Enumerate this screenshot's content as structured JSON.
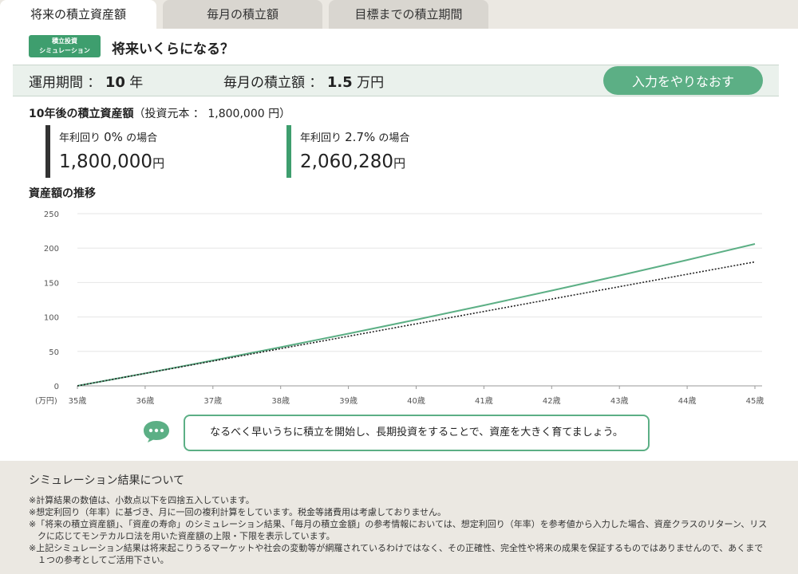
{
  "tabs": [
    {
      "label": "将来の積立資産額",
      "active": true
    },
    {
      "label": "毎月の積立額",
      "active": false
    },
    {
      "label": "目標までの積立期間",
      "active": false
    }
  ],
  "badge": {
    "line1": "積立投資",
    "line2": "シミュレーション"
  },
  "page_title": "将来いくらになる？",
  "conditions": {
    "period_label": "運用期間 ：",
    "period_value": "10",
    "period_unit": "年",
    "monthly_label": "毎月の積立額 ：",
    "monthly_value": "1.5",
    "monthly_unit": "万円",
    "reset_label": "入力をやりなおす"
  },
  "result": {
    "title": "10年後の積立資産額",
    "principal": "（投資元本 ： 1,800,000 円）",
    "scenarios": [
      {
        "prefix": "年利回り ",
        "rate": "0%",
        "suffix": " の場合",
        "amount": "1,800,000",
        "unit": "円",
        "color": "#333333"
      },
      {
        "prefix": "年利回り ",
        "rate": "2.7%",
        "suffix": " の場合",
        "amount": "2,060,280",
        "unit": "円",
        "color": "#3e9e6e"
      }
    ]
  },
  "chart_title": "資産額の推移",
  "chart_data": {
    "type": "line",
    "x": [
      "35歳",
      "36歳",
      "37歳",
      "38歳",
      "39歳",
      "40歳",
      "41歳",
      "42歳",
      "43歳",
      "44歳",
      "45歳"
    ],
    "yticks": [
      "0",
      "50",
      "100",
      "150",
      "200",
      "250"
    ],
    "ylim": [
      0,
      250
    ],
    "yunit": "(万円)",
    "grid": true,
    "series": [
      {
        "style": "solid",
        "color": "#5caf85",
        "values": [
          0,
          18.2,
          36.9,
          56.1,
          75.8,
          96.1,
          116.9,
          138.3,
          160.2,
          182.8,
          206.0
        ]
      },
      {
        "style": "dotted",
        "color": "#222222",
        "values": [
          0,
          18,
          36,
          54,
          72,
          90,
          108,
          126,
          144,
          162,
          180
        ]
      }
    ]
  },
  "tip": "なるべく早いうちに積立を開始し、長期投資をすることで、資産を大きく育てましょう。",
  "notes": {
    "title": "シミュレーション結果について",
    "items": [
      "※計算結果の数値は、小数点以下を四捨五入しています。",
      "※想定利回り（年率）に基づき、月に一回の複利計算をしています。税金等諸費用は考慮しておりません。",
      "※「将来の積立資産額」、「資産の寿命」のシミュレーション結果、「毎月の積立金額」の参考情報においては、想定利回り（年率）を参考値から入力した場合、資産クラスのリターン、リスクに応じてモンテカルロ法を用いた資産額の上限・下限を表示しています。",
      "※上記シミュレーション結果は将来起こりうるマーケットや社会の変動等が網羅されているわけではなく、その正確性、完全性や将来の成果を保証するものではありませんので、あくまで１つの参考としてご活用下さい。"
    ]
  }
}
